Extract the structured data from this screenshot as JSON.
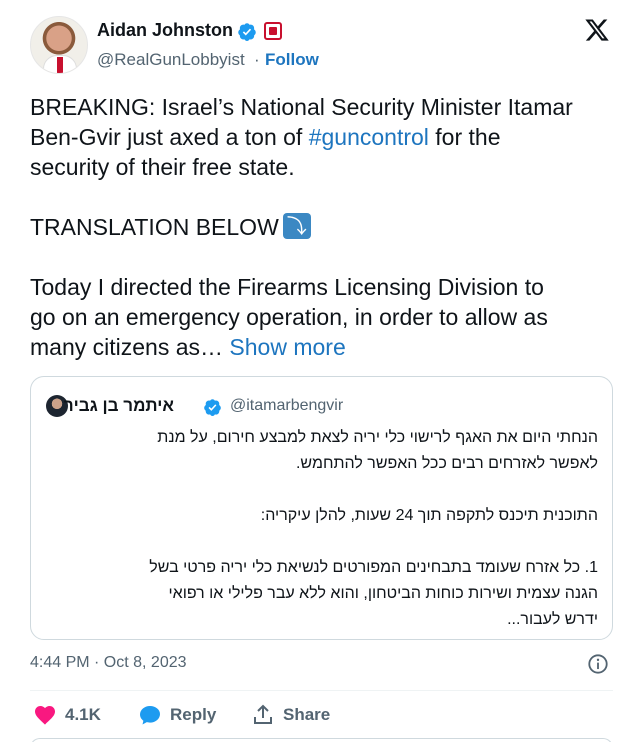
{
  "author": {
    "name": "Aidan Johnston",
    "handle": "@RealGunLobbyist",
    "separator": "·",
    "follow_label": "Follow"
  },
  "tweet": {
    "lines": [
      "BREAKING: Israel’s National Security Minister Itamar",
      "Ben-Gvir just axed a ton of ",
      "security of their free state."
    ],
    "hashtag": "#guncontrol",
    "after_hashtag": " for the",
    "translation_label": "TRANSLATION BELOW",
    "body_lines": [
      "Today I directed the Firearms Licensing Division to",
      "go on an emergency operation, in order to allow as",
      "many citizens as… "
    ],
    "show_more": "Show more"
  },
  "quote": {
    "name": "איתמר בן גביר",
    "handle": "@itamarbengvir",
    "lines": [
      "הנחתי היום את האגף לרישוי כלי יריה לצאת למבצע חירום, על מנת",
      "לאפשר לאזרחים רבים ככל האפשר להתחמש.",
      "",
      "התוכנית תיכנס לתקפה תוך 24 שעות, להלן עיקריה:",
      "",
      "1. כל אזרח שעומד בתבחינים המפורטים לנשיאת כלי יריה פרטי בשל",
      "הגנה עצמית ושירות כוחות הביטחון, והוא ללא עבר פלילי או רפואי",
      "ידרש לעבור..."
    ]
  },
  "meta": {
    "timestamp": "4:44 PM · Oct 8, 2023"
  },
  "actions": {
    "like_count": "4.1K",
    "reply_label": "Reply",
    "share_label": "Share"
  },
  "icons": {
    "verified": "verified-badge-icon",
    "x_logo": "x-logo-icon",
    "info": "info-icon",
    "like": "heart-icon",
    "reply": "speech-bubble-icon",
    "share": "share-upload-icon"
  },
  "colors": {
    "link": "#1d75bf",
    "verified": "#1d9bf0",
    "heart": "#f91880",
    "muted": "#536471",
    "border": "#cfd9de"
  }
}
